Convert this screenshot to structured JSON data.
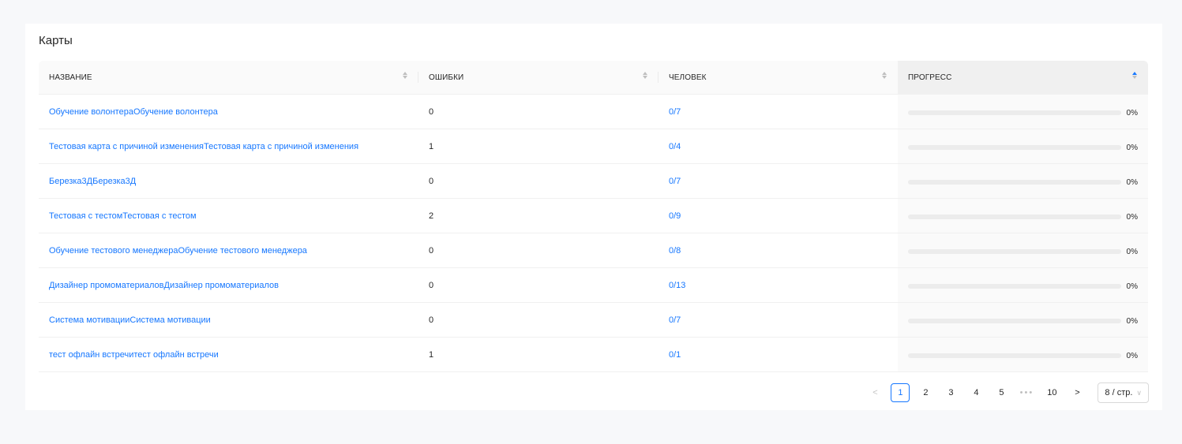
{
  "title": "Карты",
  "columns": [
    {
      "label": "НАЗВАНИЕ"
    },
    {
      "label": "ОШИБКИ"
    },
    {
      "label": "ЧЕЛОВЕК"
    },
    {
      "label": "ПРОГРЕСС"
    }
  ],
  "rows": [
    {
      "name": "Обучение волонтераОбучение волонтера",
      "errors": "0",
      "people": "0/7",
      "progress": 0,
      "progress_label": "0%"
    },
    {
      "name": "Тестовая карта с причиной измененияТестовая карта с причиной изменения",
      "errors": "1",
      "people": "0/4",
      "progress": 0,
      "progress_label": "0%"
    },
    {
      "name": "Березка3ДБерезка3Д",
      "errors": "0",
      "people": "0/7",
      "progress": 0,
      "progress_label": "0%"
    },
    {
      "name": "Тестовая с тестомТестовая с тестом",
      "errors": "2",
      "people": "0/9",
      "progress": 0,
      "progress_label": "0%"
    },
    {
      "name": "Обучение тестового менеджераОбучение тестового менеджера",
      "errors": "0",
      "people": "0/8",
      "progress": 0,
      "progress_label": "0%"
    },
    {
      "name": "Дизайнер промоматериаловДизайнер промоматериалов",
      "errors": "0",
      "people": "0/13",
      "progress": 0,
      "progress_label": "0%"
    },
    {
      "name": "Система мотивацииСистема мотивации",
      "errors": "0",
      "people": "0/7",
      "progress": 0,
      "progress_label": "0%"
    },
    {
      "name": "тест офлайн встречитест офлайн встречи",
      "errors": "1",
      "people": "0/1",
      "progress": 0,
      "progress_label": "0%"
    }
  ],
  "pagination": {
    "prev": "<",
    "pages": [
      "1",
      "2",
      "3",
      "4",
      "5"
    ],
    "ellipsis": "•••",
    "last": "10",
    "next": ">",
    "current": "1",
    "page_size": "8 / стр."
  },
  "colors": {
    "accent": "#1677ff",
    "track": "#ececec"
  },
  "icons": {
    "sort": "sort-caret-icon",
    "select": "chevron-down-icon"
  }
}
